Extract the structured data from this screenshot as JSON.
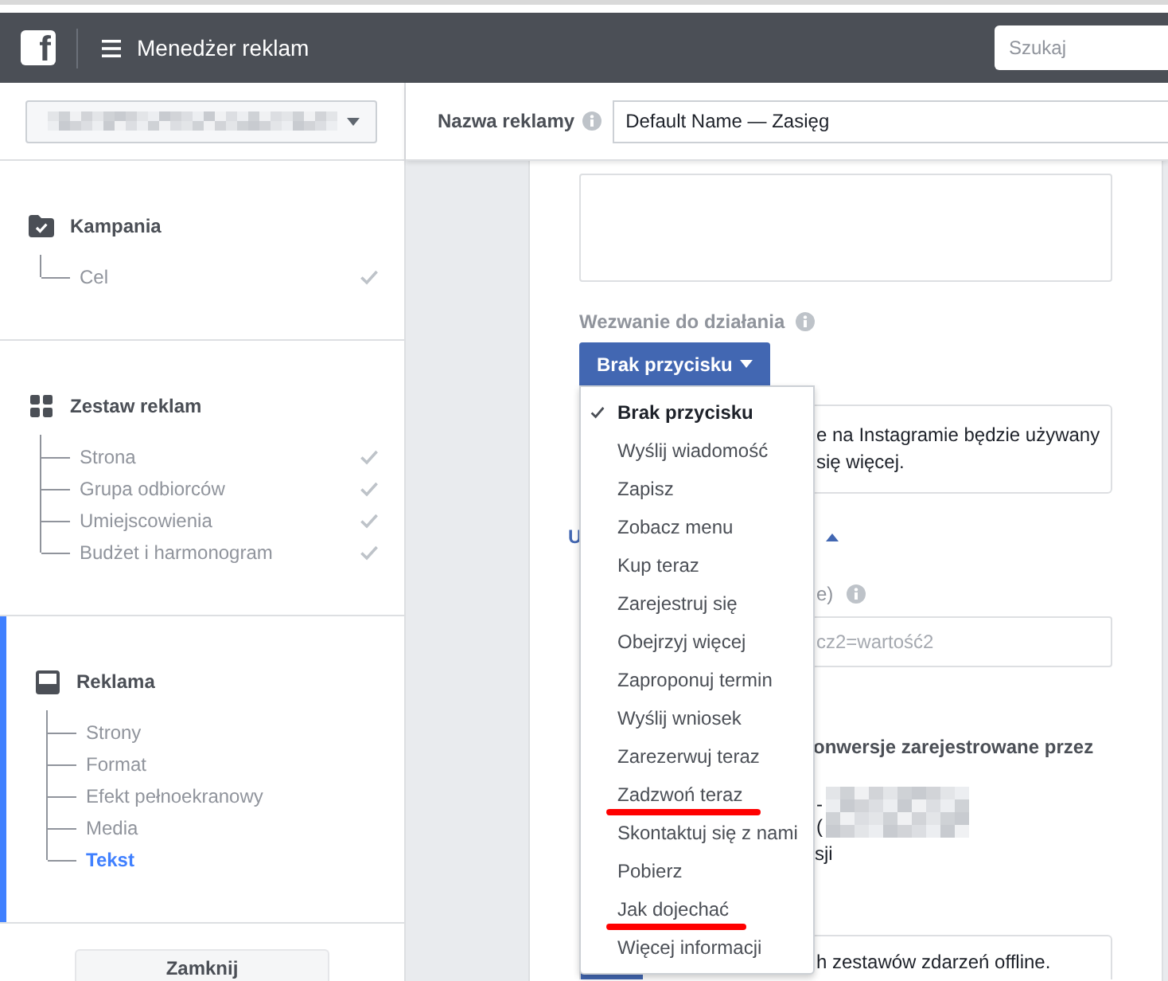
{
  "header": {
    "logo": "f",
    "title": "Menedżer reklam",
    "search": {
      "placeholder": "Szukaj"
    }
  },
  "sidebar": {
    "sections": [
      {
        "kind": "campaign",
        "title": "Kampania",
        "selected": false,
        "items": [
          {
            "label": "Cel",
            "done": true,
            "selected": false
          }
        ]
      },
      {
        "kind": "ad_set",
        "title": "Zestaw reklam",
        "selected": false,
        "items": [
          {
            "label": "Strona",
            "done": true,
            "selected": false
          },
          {
            "label": "Grupa odbiorców",
            "done": true,
            "selected": false
          },
          {
            "label": "Umiejscowienia",
            "done": true,
            "selected": false
          },
          {
            "label": "Budżet i harmonogram",
            "done": true,
            "selected": false
          }
        ]
      },
      {
        "kind": "ad",
        "title": "Reklama",
        "selected": true,
        "items": [
          {
            "label": "Strony",
            "done": false,
            "selected": false
          },
          {
            "label": "Format",
            "done": false,
            "selected": false
          },
          {
            "label": "Efekt pełnoekranowy",
            "done": false,
            "selected": false
          },
          {
            "label": "Media",
            "done": false,
            "selected": false
          },
          {
            "label": "Tekst",
            "done": false,
            "selected": true
          }
        ]
      }
    ],
    "close_button": "Zamknij"
  },
  "ad_name": {
    "label": "Nazwa reklamy",
    "value": "Default Name — Zasięg"
  },
  "call_to_action": {
    "label": "Wezwanie do działania",
    "button": "Brak przycisku",
    "expanded": true,
    "menu_items": [
      {
        "label": "Brak przycisku",
        "selected": true,
        "underlined": false
      },
      {
        "label": "Wyślij wiadomość",
        "selected": false,
        "underlined": false
      },
      {
        "label": "Zapisz",
        "selected": false,
        "underlined": false
      },
      {
        "label": "Zobacz menu",
        "selected": false,
        "underlined": false
      },
      {
        "label": "Kup teraz",
        "selected": false,
        "underlined": false
      },
      {
        "label": "Zarejestruj się",
        "selected": false,
        "underlined": false
      },
      {
        "label": "Obejrzyj więcej",
        "selected": false,
        "underlined": false
      },
      {
        "label": "Zaproponuj termin",
        "selected": false,
        "underlined": false
      },
      {
        "label": "Wyślij wniosek",
        "selected": false,
        "underlined": false
      },
      {
        "label": "Zarezerwuj teraz",
        "selected": false,
        "underlined": false
      },
      {
        "label": "Zadzwoń teraz",
        "selected": false,
        "underlined": true
      },
      {
        "label": "Skontaktuj się z nami",
        "selected": false,
        "underlined": false
      },
      {
        "label": "Pobierz",
        "selected": false,
        "underlined": false
      },
      {
        "label": "Jak dojechać",
        "selected": false,
        "underlined": true
      },
      {
        "label": "Więcej informacji",
        "selected": false,
        "underlined": false
      }
    ]
  },
  "covered_content": {
    "info_box_lines": [
      "e na Instagramie będzie używany",
      "się więcej."
    ],
    "link": "U",
    "field_label": "e)",
    "field_placeholder": "cz2=wartość2",
    "heading": "onwersje zarejestrowane przez",
    "fragments": [
      "-",
      "("
    ],
    "text": "sji",
    "bottom_box_text": "h zestawów zdarzeń offline."
  }
}
